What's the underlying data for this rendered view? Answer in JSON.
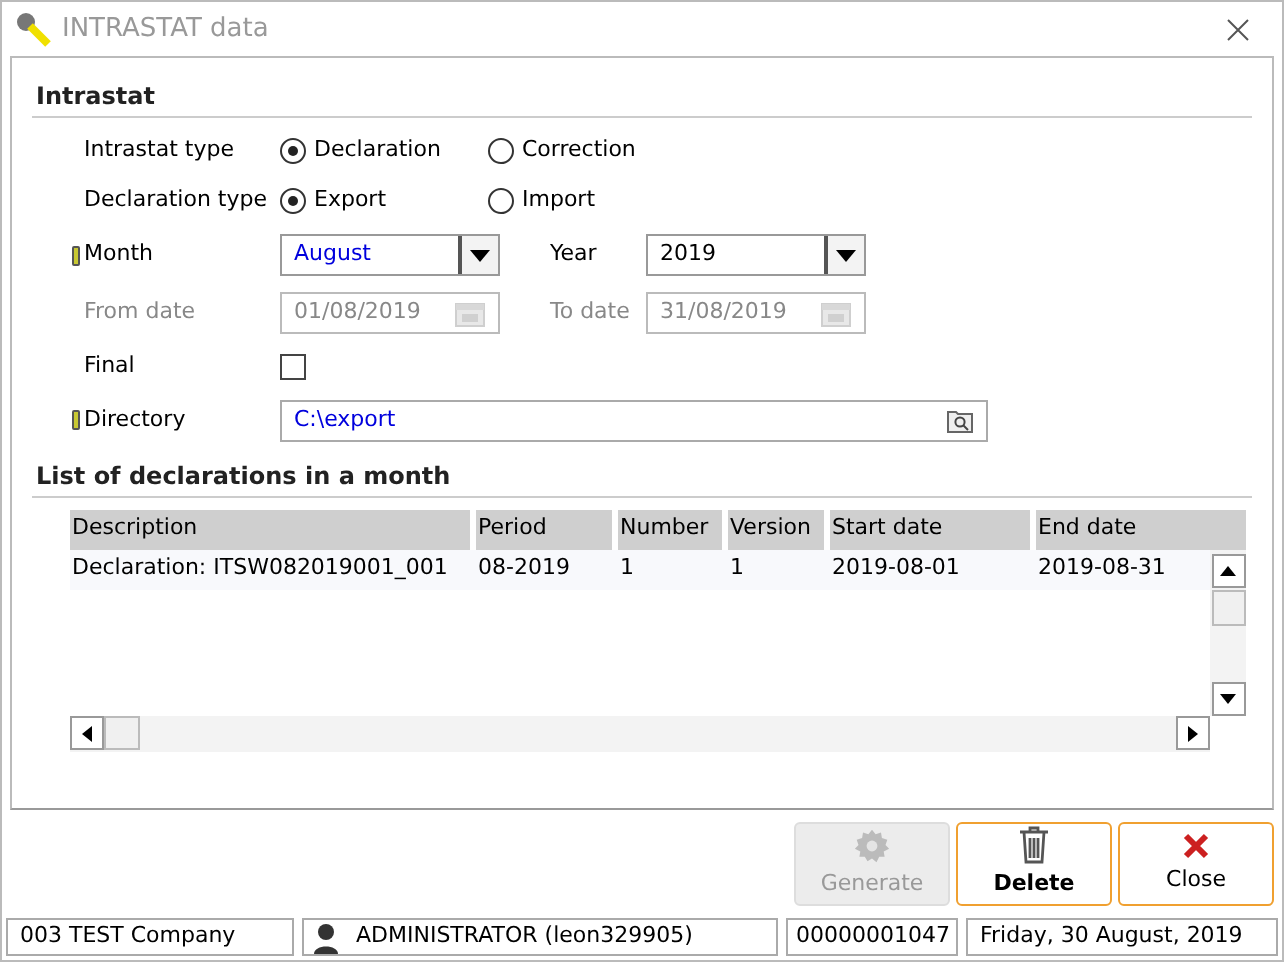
{
  "window": {
    "title": "INTRASTAT data"
  },
  "intrastat": {
    "heading": "Intrastat",
    "intrastat_type": {
      "label": "Intrastat type",
      "options": [
        {
          "label": "Declaration",
          "selected": true
        },
        {
          "label": "Correction",
          "selected": false
        }
      ]
    },
    "declaration_type": {
      "label": "Declaration type",
      "options": [
        {
          "label": "Export",
          "selected": true
        },
        {
          "label": "Import",
          "selected": false
        }
      ]
    },
    "month": {
      "label": "Month",
      "required": true,
      "value": "August"
    },
    "year": {
      "label": "Year",
      "value": "2019"
    },
    "from_date": {
      "label": "From date",
      "value": "01/08/2019",
      "disabled": true
    },
    "to_date": {
      "label": "To date",
      "value": "31/08/2019",
      "disabled": true
    },
    "final": {
      "label": "Final",
      "checked": false
    },
    "directory": {
      "label": "Directory",
      "required": true,
      "value": "C:\\export"
    }
  },
  "list": {
    "heading": "List of declarations in a month",
    "columns": [
      "Description",
      "Period",
      "Number",
      "Version",
      "Start date",
      "End date"
    ],
    "rows": [
      [
        "Declaration: ITSW082019001_001",
        "08-2019",
        "1",
        "1",
        "2019-08-01",
        "2019-08-31"
      ]
    ]
  },
  "buttons": [
    {
      "kind": "gear",
      "label": "Generate",
      "disabled": true,
      "default": false
    },
    {
      "kind": "trash",
      "label": "Delete",
      "disabled": false,
      "default": true
    },
    {
      "kind": "cross",
      "label": "Close",
      "disabled": false,
      "default": false
    }
  ],
  "status_bar": {
    "company": "003 TEST Company",
    "user": "ADMINISTRATOR (leon329905)",
    "number": "00000001047",
    "date": "Friday, 30 August, 2019"
  }
}
